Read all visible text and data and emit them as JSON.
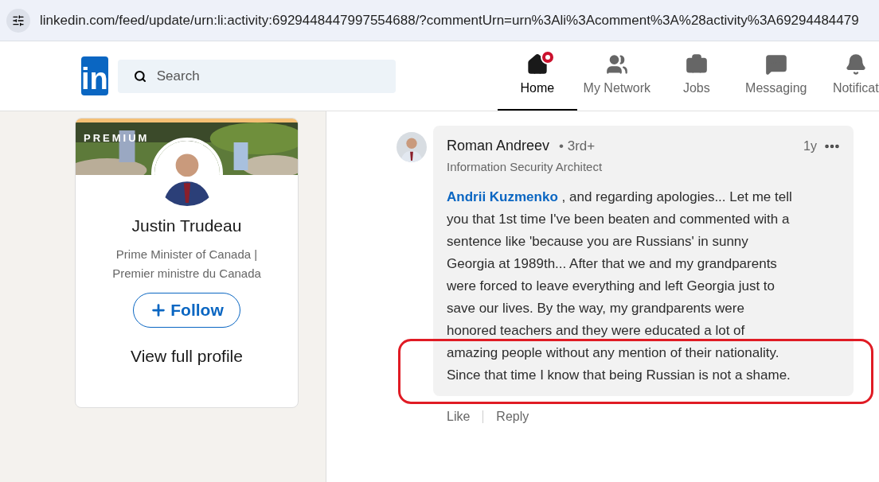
{
  "address_bar": {
    "url": "linkedin.com/feed/update/urn:li:activity:6929448447997554688/?commentUrn=urn%3Ali%3Acomment%3A%28activity%3A69294484479"
  },
  "header": {
    "logo": "in",
    "search": {
      "placeholder": "Search"
    },
    "nav": [
      {
        "label": "Home",
        "selected": true,
        "badge": true
      },
      {
        "label": "My Network",
        "selected": false,
        "badge": false
      },
      {
        "label": "Jobs",
        "selected": false,
        "badge": false
      },
      {
        "label": "Messaging",
        "selected": false,
        "badge": false
      },
      {
        "label": "Notificat",
        "selected": false,
        "badge": false
      }
    ]
  },
  "profile_card": {
    "banner_label": "PREMIUM",
    "name": "Justin Trudeau",
    "headline": "Prime Minister of Canada | Premier ministre du Canada",
    "follow_button": "Follow",
    "view_profile": "View full profile"
  },
  "comment": {
    "author": "Roman Andreev",
    "degree": "• 3rd+",
    "title": "Information Security Architect",
    "time": "1y",
    "paragraphs": [
      {
        "mention": "Andrii Kuzmenko",
        "text": " , and regarding apologies... Let me tell you that 1st time I've been beaten and commented with a sentence like 'because you are Russians' in sunny Georgia at 1989th... After that we and my grandparents were forced to leave everything and left Georgia just to save our lives. By the way, my grandparents were honored teachers and they were educated a lot of amazing people without any mention of their nationality."
      },
      {
        "text": "Since that time I know that being Russian is not a shame."
      }
    ],
    "actions": [
      "Like",
      "Reply"
    ],
    "highlighted": true
  }
}
